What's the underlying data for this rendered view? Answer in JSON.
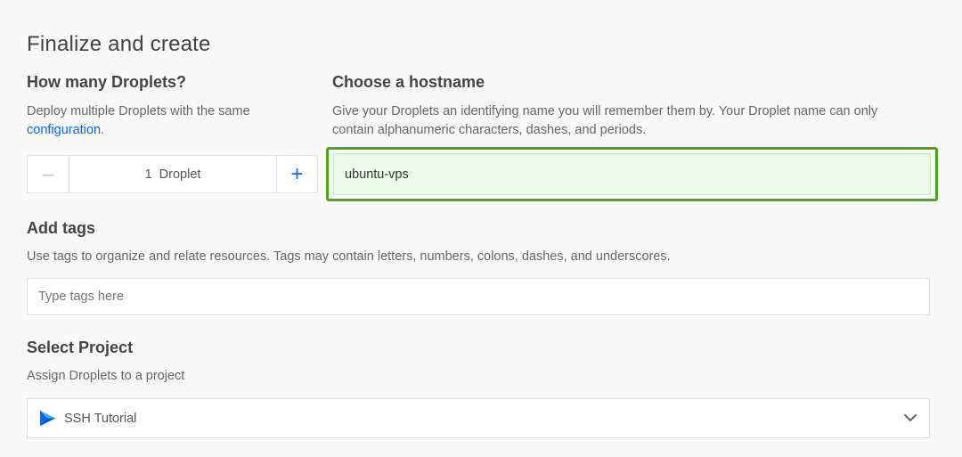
{
  "section": {
    "title": "Finalize and create"
  },
  "droplets": {
    "heading": "How many Droplets?",
    "desc_prefix": "Deploy multiple Droplets with the same",
    "desc_link": "configuration",
    "desc_suffix": ".",
    "minus_symbol": "–",
    "plus_symbol": "+",
    "count_text": "1  Droplet"
  },
  "hostname": {
    "heading": "Choose a hostname",
    "desc": "Give your Droplets an identifying name you will remember them by. Your Droplet name can only contain alphanumeric characters, dashes, and periods.",
    "value": "ubuntu-vps"
  },
  "tags": {
    "heading": "Add tags",
    "desc": "Use tags to organize and relate resources. Tags may contain letters, numbers, colons, dashes, and underscores.",
    "placeholder": "Type tags here"
  },
  "project": {
    "heading": "Select Project",
    "desc": "Assign Droplets to a project",
    "selected": "SSH Tutorial",
    "icon": "project-flag-icon"
  },
  "colors": {
    "accent": "#0069ff",
    "highlight_border": "#4ca61c",
    "input_highlight_bg": "#edfbea"
  }
}
